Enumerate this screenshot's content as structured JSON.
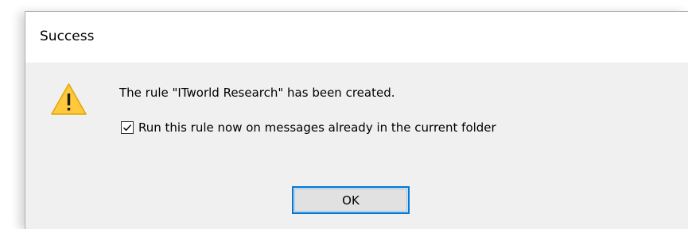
{
  "dialog": {
    "title": "Success",
    "icon": "warning-icon",
    "message": "The rule \"ITworld Research\" has been created.",
    "checkbox": {
      "label": "Run this rule now on messages already in the current folder",
      "checked": true
    },
    "ok_label": "OK"
  },
  "colors": {
    "accent": "#0078d7",
    "warning_fill": "#ffc83d",
    "dialog_bg": "#f0f0f0",
    "titlebar_bg": "#ffffff"
  }
}
